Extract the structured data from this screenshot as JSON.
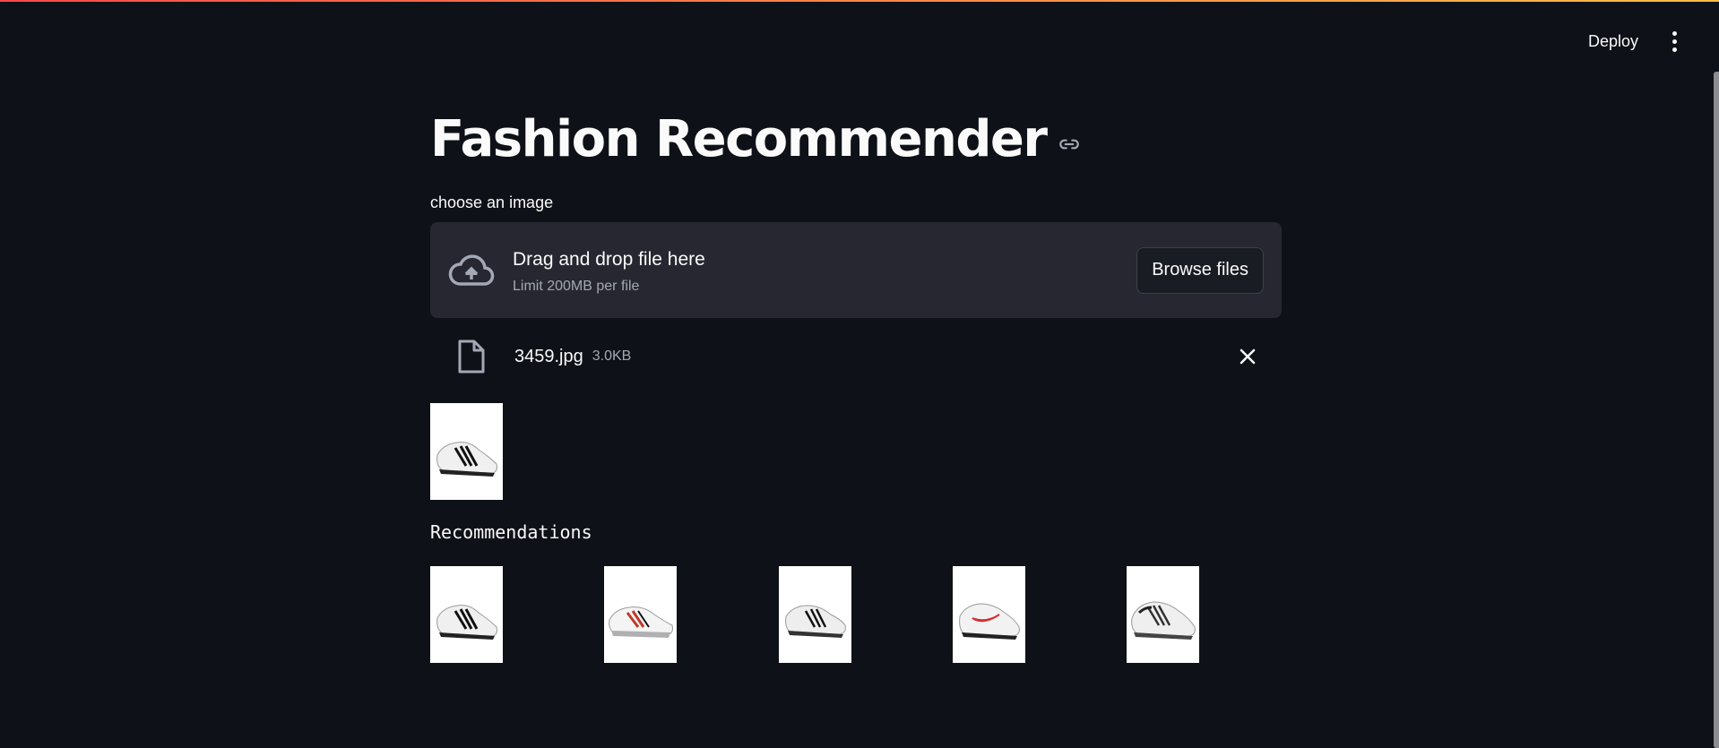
{
  "header": {
    "deploy_label": "Deploy"
  },
  "main": {
    "title": "Fashion Recommender",
    "uploader": {
      "label": "choose an image",
      "drop_text": "Drag and drop file here",
      "limit_text": "Limit 200MB per file",
      "browse_label": "Browse files"
    },
    "uploaded_file": {
      "name": "3459.jpg",
      "size": "3.0KB"
    },
    "recommendations_heading": "Recommendations",
    "recommendations_count": 5
  },
  "icons": {
    "link": "link-icon",
    "upload": "cloud-upload-icon",
    "file": "file-icon",
    "close": "close-icon",
    "menu": "kebab-menu-icon"
  },
  "colors": {
    "background": "#0e1117",
    "dropzone": "#262730",
    "text": "#fafafa",
    "muted": "#a3a8b4",
    "top_gradient_start": "#ff4b4b",
    "top_gradient_end": "#ffbd45"
  }
}
